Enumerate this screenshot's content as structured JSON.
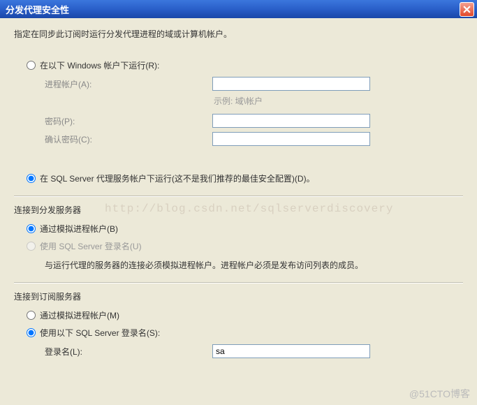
{
  "titlebar": {
    "title": "分发代理安全性"
  },
  "instruction": "指定在同步此订阅时运行分发代理进程的域或计算机帐户。",
  "runAs": {
    "windowsOption": "在以下 Windows 帐户下运行(R):",
    "processAccountLabel": "进程帐户(A):",
    "exampleLabel": "示例: 域\\帐户",
    "passwordLabel": "密码(P):",
    "confirmPasswordLabel": "确认密码(C):",
    "sqlAgentOption": "在 SQL Server 代理服务帐户下运行(这不是我们推荐的最佳安全配置)(D)。"
  },
  "distributor": {
    "title": "连接到分发服务器",
    "impersonateOption": "通过模拟进程帐户(B)",
    "sqlLoginOption": "使用 SQL Server 登录名(U)",
    "note": "与运行代理的服务器的连接必须模拟进程帐户。进程帐户必须是发布访问列表的成员。"
  },
  "subscriber": {
    "title": "连接到订阅服务器",
    "impersonateOption": "通过模拟进程帐户(M)",
    "sqlLoginOption": "使用以下 SQL Server 登录名(S):",
    "loginLabel": "登录名(L):",
    "loginValue": "sa"
  },
  "watermark": "http://blog.csdn.net/sqlserverdiscovery",
  "cornerWatermark": "@51CTO博客"
}
